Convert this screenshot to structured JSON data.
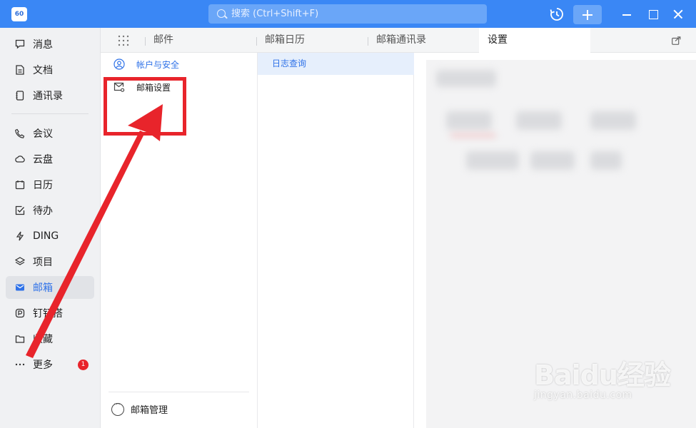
{
  "titlebar": {
    "app_badge": "60",
    "search_placeholder": "搜索 (Ctrl+Shift+F)",
    "accent_color": "#3a87f5"
  },
  "sidebar": {
    "items": [
      {
        "label": "消息",
        "icon": "message-icon"
      },
      {
        "label": "文档",
        "icon": "document-icon"
      },
      {
        "label": "通讯录",
        "icon": "contacts-icon"
      },
      {
        "label": "会议",
        "icon": "phone-icon"
      },
      {
        "label": "云盘",
        "icon": "cloud-icon"
      },
      {
        "label": "日历",
        "icon": "calendar-icon"
      },
      {
        "label": "待办",
        "icon": "todo-icon"
      },
      {
        "label": "DING",
        "icon": "lightning-icon"
      },
      {
        "label": "项目",
        "icon": "project-icon"
      },
      {
        "label": "邮箱",
        "icon": "mail-icon",
        "active": true
      },
      {
        "label": "钉钉搭",
        "icon": "builder-icon"
      },
      {
        "label": "收藏",
        "icon": "folder-icon"
      },
      {
        "label": "更多",
        "icon": "more-icon",
        "badge": "1"
      }
    ]
  },
  "tabs": [
    {
      "label": "邮件"
    },
    {
      "label": "邮箱日历"
    },
    {
      "label": "邮箱通讯录"
    },
    {
      "label": "设置",
      "active": true
    }
  ],
  "settings_menu": {
    "items": [
      {
        "label": "帐户与安全",
        "icon": "user-circle-icon",
        "active": true
      },
      {
        "label": "邮箱设置",
        "icon": "mail-settings-icon"
      }
    ],
    "footer_label": "邮箱管理"
  },
  "sub_menu": {
    "items": [
      {
        "label": "日志查询",
        "active": true
      }
    ]
  },
  "watermark": {
    "main": "Baidu经验",
    "sub": "jingyan.baidu.com"
  }
}
